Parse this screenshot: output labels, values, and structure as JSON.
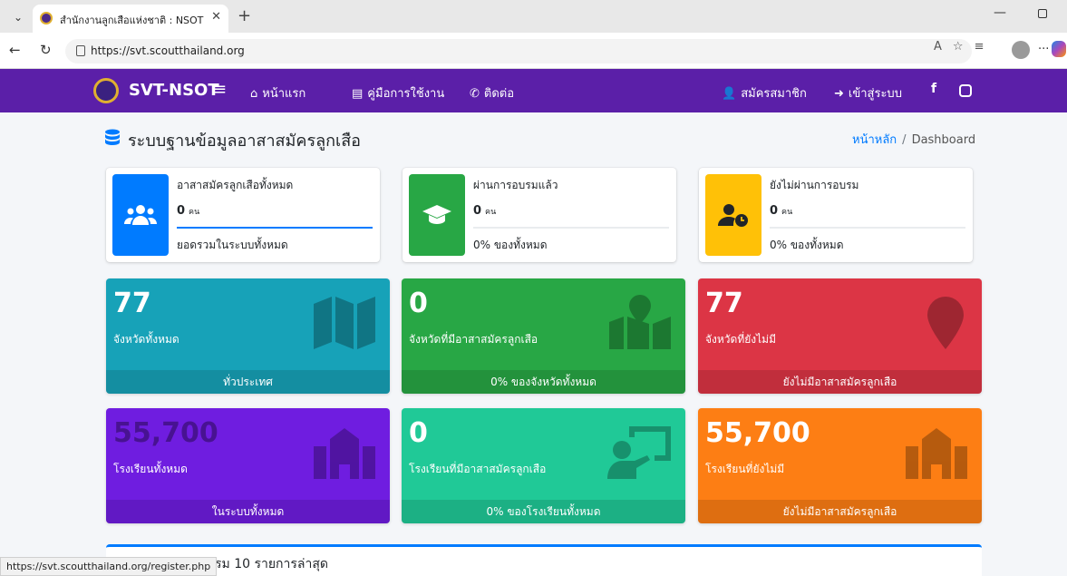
{
  "browser": {
    "tab_title": "สำนักงานลูกเสือแห่งชาติ : NSOT",
    "tab_close": "✕",
    "new_tab": "+",
    "url": "https://svt.scoutthailand.org",
    "status_url": "https://svt.scoutthailand.org/register.php"
  },
  "navbar": {
    "brand": "SVT-NSOT",
    "links": [
      {
        "icon": "home-icon",
        "label": "หน้าแรก"
      },
      {
        "icon": "book-icon",
        "label": "คู่มือการใช้งาน"
      },
      {
        "icon": "phone-icon",
        "label": "ติดต่อ"
      }
    ],
    "register": "สมัครสมาชิก",
    "login": "เข้าสู่ระบบ"
  },
  "header": {
    "title": "ระบบฐานข้อมูลอาสาสมัครลูกเสือ",
    "breadcrumb_home": "หน้าหลัก",
    "breadcrumb_sep": "/",
    "breadcrumb_current": "Dashboard"
  },
  "info_boxes": [
    {
      "title": "อาสาสมัครลูกเสือทั้งหมด",
      "value": "0",
      "unit": "คน",
      "desc": "ยอดรวมในระบบทั้งหมด",
      "color": "#007bff",
      "icon": "users-icon",
      "progress": 1.0
    },
    {
      "title": "ผ่านการอบรมแล้ว",
      "value": "0",
      "unit": "คน",
      "desc": "0% ของทั้งหมด",
      "color": "#28a745",
      "icon": "graduation-cap-icon",
      "progress": 0
    },
    {
      "title": "ยังไม่ผ่านการอบรม",
      "value": "0",
      "unit": "คน",
      "desc": "0% ของทั้งหมด",
      "color": "#ffc107",
      "icon": "user-clock-icon",
      "progress": 0
    }
  ],
  "small_boxes": [
    {
      "value": "77",
      "label": "จังหวัดทั้งหมด",
      "footer": "ทั่วประเทศ",
      "color": "#17a2b8",
      "icon": "map-icon"
    },
    {
      "value": "0",
      "label": "จังหวัดที่มีอาสาสมัครลูกเสือ",
      "footer": "0% ของจังหวัดทั้งหมด",
      "color": "#28a745",
      "icon": "map-marked-icon"
    },
    {
      "value": "77",
      "label": "จังหวัดที่ยังไม่มี",
      "footer": "ยังไม่มีอาสาสมัครลูกเสือ",
      "color": "#dc3545",
      "icon": "map-marker-icon"
    },
    {
      "value": "55,700",
      "label": "โรงเรียนทั้งหมด",
      "footer": "ในระบบทั้งหมด",
      "color": "#6f1de0",
      "icon": "school-icon"
    },
    {
      "value": "0",
      "label": "โรงเรียนที่มีอาสาสมัครลูกเสือ",
      "footer": "0% ของโรงเรียนทั้งหมด",
      "color": "#20c997",
      "icon": "chalkboard-teacher-icon"
    },
    {
      "value": "55,700",
      "label": "โรงเรียนที่ยังไม่มี",
      "footer": "ยังไม่มีอาสาสมัครลูกเสือ",
      "color": "#fd7e14",
      "icon": "school-icon"
    }
  ],
  "recent_card": {
    "title_partial": "รม 10 รายการล่าสุด"
  }
}
